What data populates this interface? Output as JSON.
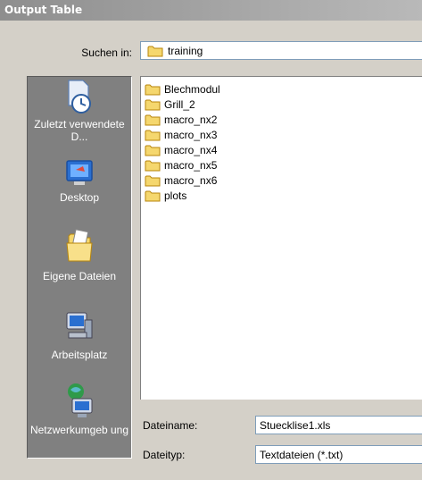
{
  "window": {
    "title": "Output Table"
  },
  "lookin": {
    "label": "Suchen in:",
    "value": "training"
  },
  "places": [
    {
      "label": "Zuletzt verwendete D..."
    },
    {
      "label": "Desktop"
    },
    {
      "label": "Eigene Dateien"
    },
    {
      "label": "Arbeitsplatz"
    },
    {
      "label": "Netzwerkumgeb ung"
    }
  ],
  "files": [
    "Blechmodul",
    "Grill_2",
    "macro_nx2",
    "macro_nx3",
    "macro_nx4",
    "macro_nx5",
    "macro_nx6",
    "plots"
  ],
  "filename": {
    "label": "Dateiname:",
    "value": "Stuecklise1.xls"
  },
  "filetype": {
    "label": "Dateityp:",
    "value": "Textdateien (*.txt)"
  },
  "colors": {
    "titlebar": "#8e8e8e",
    "places_bg": "#808080",
    "folder": "#f5d76e",
    "window_bg": "#d4d0c8"
  }
}
